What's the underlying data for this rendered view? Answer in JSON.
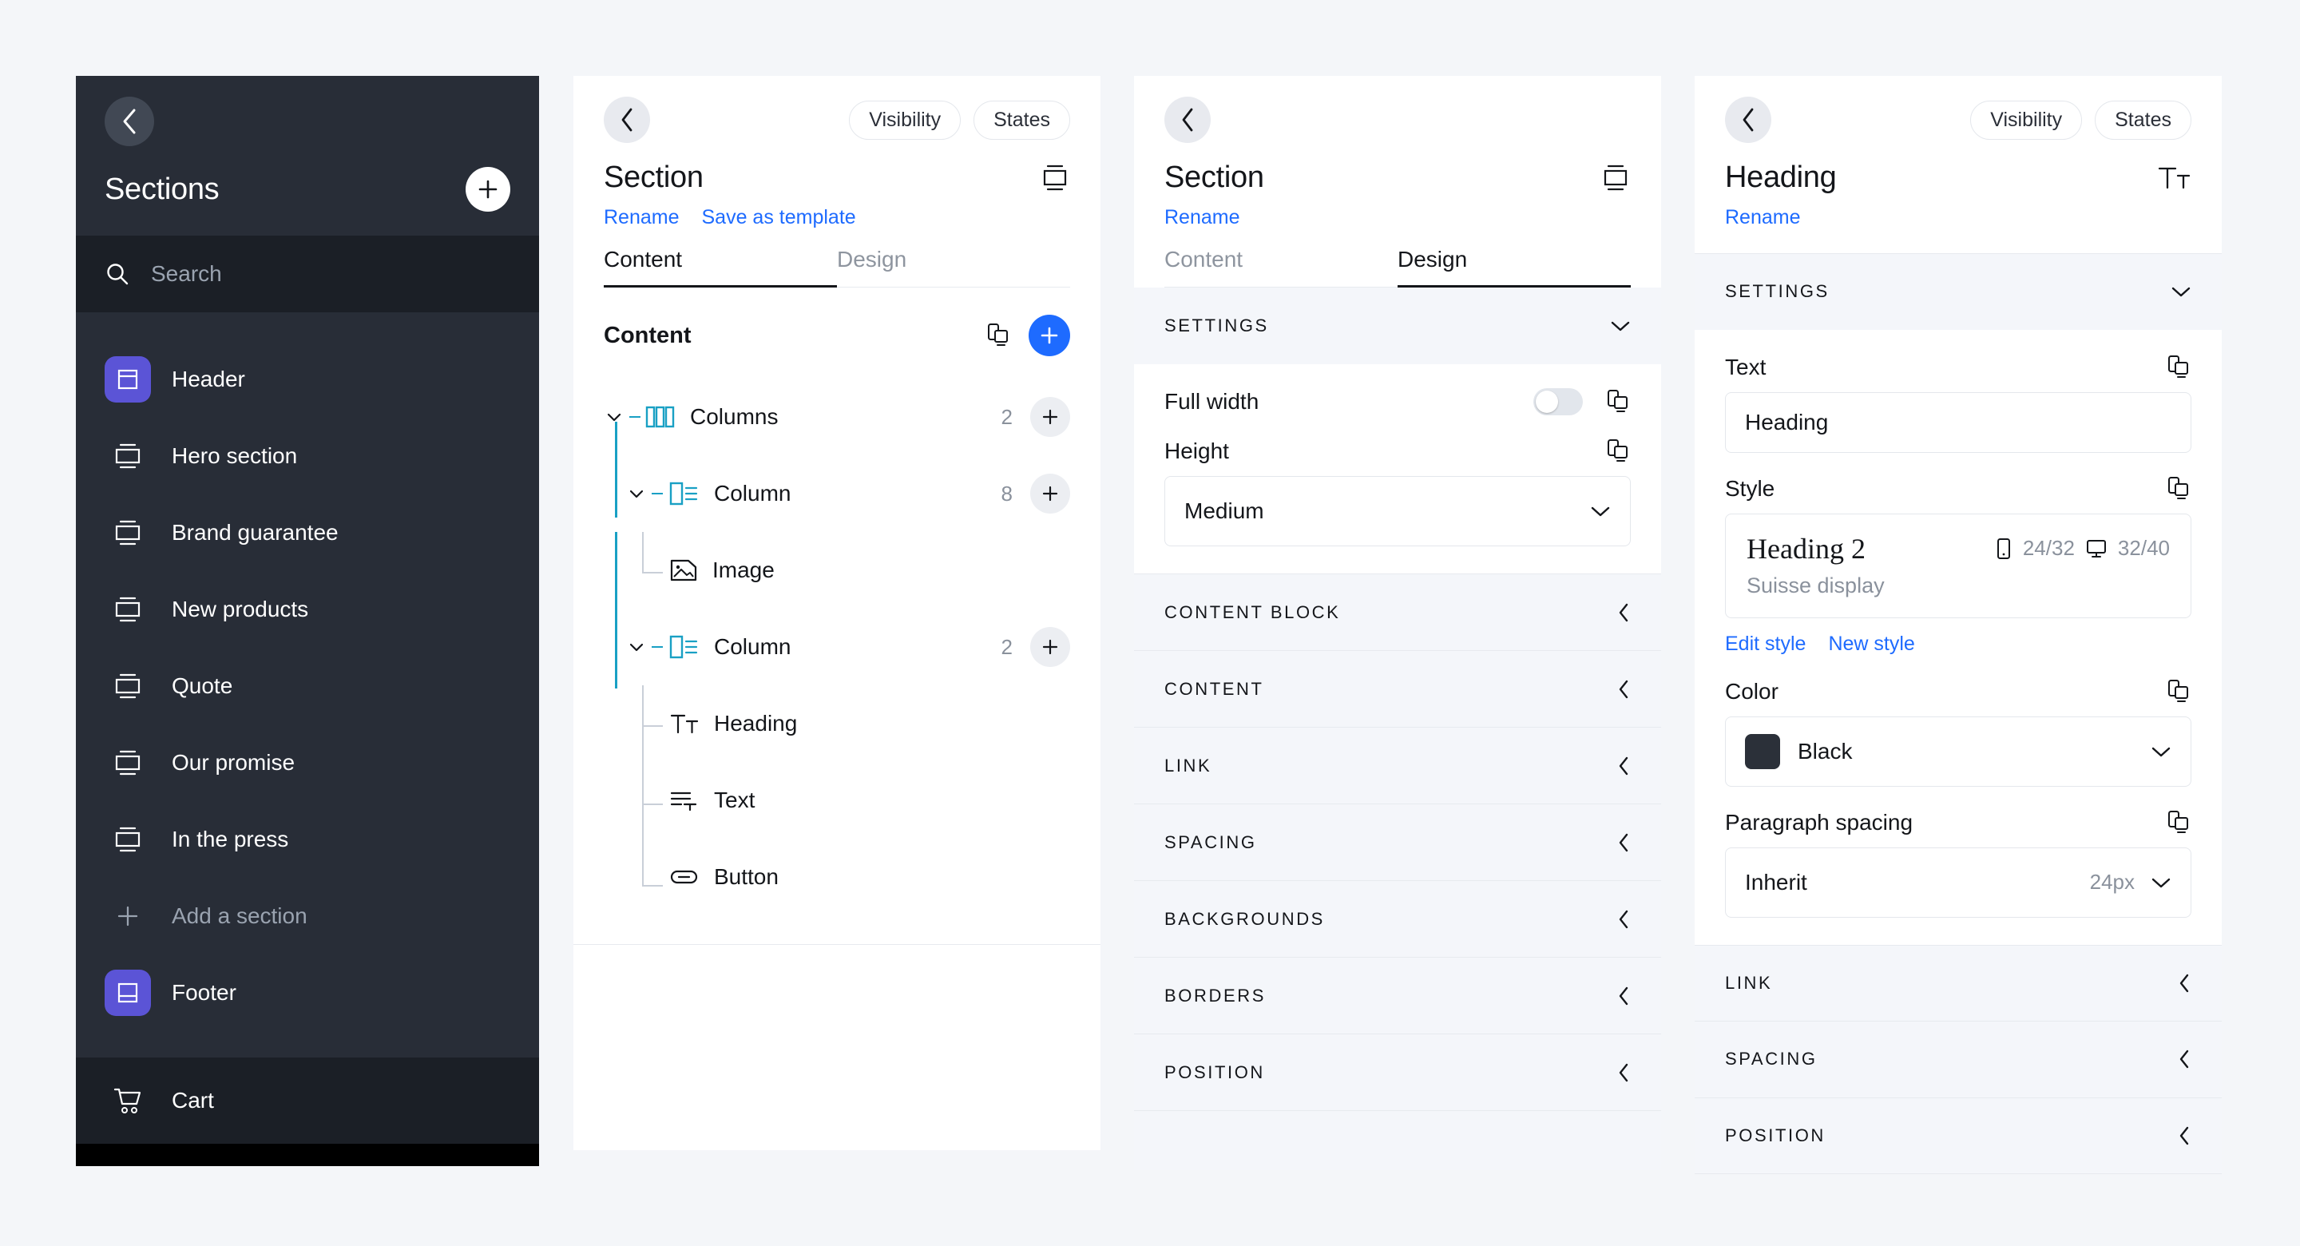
{
  "sections_panel": {
    "back_icon": "chevron-left-icon",
    "title": "Sections",
    "add_icon": "plus-icon",
    "search": {
      "placeholder": "Search",
      "icon": "search-icon"
    },
    "items": [
      {
        "label": "Header",
        "icon": "header-section-icon",
        "highlighted": true
      },
      {
        "label": "Hero section",
        "icon": "section-icon",
        "highlighted": false
      },
      {
        "label": "Brand guarantee",
        "icon": "section-icon",
        "highlighted": false
      },
      {
        "label": "New products",
        "icon": "section-icon",
        "highlighted": false
      },
      {
        "label": "Quote",
        "icon": "section-icon",
        "highlighted": false
      },
      {
        "label": "Our promise",
        "icon": "section-icon",
        "highlighted": false
      },
      {
        "label": "In the press",
        "icon": "section-icon",
        "highlighted": false
      }
    ],
    "add_section": {
      "label": "Add a section",
      "icon": "plus-icon"
    },
    "footer_item": {
      "label": "Footer",
      "icon": "footer-section-icon"
    },
    "cart_item": {
      "label": "Cart",
      "icon": "cart-icon"
    },
    "colors": {
      "accent": "#5b54d6",
      "background": "#282d37",
      "search_bg": "#1b1f26"
    }
  },
  "section_content_panel": {
    "back_icon": "chevron-left-icon",
    "pills": [
      "Visibility",
      "States"
    ],
    "title": "Section",
    "title_icon": "section-icon",
    "links": [
      "Rename",
      "Save as template"
    ],
    "tabs": [
      {
        "label": "Content",
        "active": true
      },
      {
        "label": "Design",
        "active": false
      }
    ],
    "content_header": {
      "label": "Content",
      "copy_icon": "copy-to-device-icon",
      "add_icon": "plus-icon"
    },
    "tree": [
      {
        "label": "Columns",
        "icon": "columns-icon",
        "count": "2",
        "depth": 0,
        "expanded": true,
        "add": true
      },
      {
        "label": "Column",
        "icon": "column-icon",
        "count": "8",
        "depth": 1,
        "expanded": true,
        "add": true
      },
      {
        "label": "Image",
        "icon": "image-icon",
        "count": "",
        "depth": 2,
        "expanded": false,
        "add": false
      },
      {
        "label": "Column",
        "icon": "column-icon",
        "count": "2",
        "depth": 1,
        "expanded": true,
        "add": true
      },
      {
        "label": "Heading",
        "icon": "heading-icon",
        "count": "",
        "depth": 2,
        "expanded": false,
        "add": false
      },
      {
        "label": "Text",
        "icon": "text-icon",
        "count": "",
        "depth": 2,
        "expanded": false,
        "add": false
      },
      {
        "label": "Button",
        "icon": "button-icon",
        "count": "",
        "depth": 2,
        "expanded": false,
        "add": false
      }
    ]
  },
  "section_design_panel": {
    "back_icon": "chevron-left-icon",
    "title": "Section",
    "title_icon": "section-icon",
    "links": [
      "Rename"
    ],
    "tabs": [
      {
        "label": "Content",
        "active": false
      },
      {
        "label": "Design",
        "active": true
      }
    ],
    "settings": {
      "label": "SETTINGS",
      "chevron": "chevron-down-icon",
      "full_width": {
        "label": "Full width",
        "value": "off",
        "copy_icon": "copy-to-device-icon"
      },
      "height": {
        "label": "Height",
        "value": "Medium",
        "copy_icon": "copy-to-device-icon",
        "chevron": "chevron-down-icon"
      }
    },
    "accordions": [
      {
        "label": "CONTENT BLOCK",
        "chevron": "chevron-left-icon"
      },
      {
        "label": "CONTENT",
        "chevron": "chevron-left-icon"
      },
      {
        "label": "LINK",
        "chevron": "chevron-left-icon"
      },
      {
        "label": "SPACING",
        "chevron": "chevron-left-icon"
      },
      {
        "label": "BACKGROUNDS",
        "chevron": "chevron-left-icon"
      },
      {
        "label": "BORDERS",
        "chevron": "chevron-left-icon"
      },
      {
        "label": "POSITION",
        "chevron": "chevron-left-icon"
      }
    ]
  },
  "heading_panel": {
    "back_icon": "chevron-left-icon",
    "pills": [
      "Visibility",
      "States"
    ],
    "title": "Heading",
    "title_icon": "heading-icon",
    "links": [
      "Rename"
    ],
    "settings": {
      "label": "SETTINGS",
      "chevron": "chevron-down-icon"
    },
    "text_field": {
      "label": "Text",
      "value": "Heading",
      "copy_icon": "copy-to-device-icon"
    },
    "style_field": {
      "label": "Style",
      "copy_icon": "copy-to-device-icon",
      "sample": "Heading 2",
      "family": "Suisse display",
      "mobile_icon": "mobile-icon",
      "mobile_metric": "24/32",
      "desktop_icon": "desktop-icon",
      "desktop_metric": "32/40",
      "actions": [
        "Edit style",
        "New style"
      ]
    },
    "color_field": {
      "label": "Color",
      "copy_icon": "copy-to-device-icon",
      "value": "Black",
      "swatch": "#2b3039",
      "chevron": "chevron-down-icon"
    },
    "paragraph_spacing_field": {
      "label": "Paragraph spacing",
      "copy_icon": "copy-to-device-icon",
      "value": "Inherit",
      "unit": "24px",
      "chevron": "chevron-down-icon"
    },
    "accordions": [
      {
        "label": "LINK",
        "chevron": "chevron-left-icon"
      },
      {
        "label": "SPACING",
        "chevron": "chevron-left-icon"
      },
      {
        "label": "POSITION",
        "chevron": "chevron-left-icon"
      }
    ]
  }
}
